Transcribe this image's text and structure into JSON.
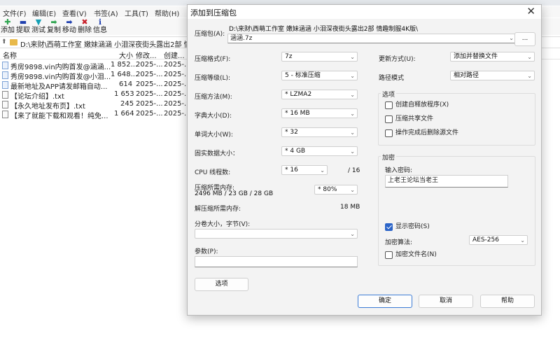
{
  "background": {
    "menu": [
      "文件(F)",
      "编辑(E)",
      "查看(V)",
      "书签(A)",
      "工具(T)",
      "帮助(H)"
    ],
    "toolbar": [
      {
        "label": "添加",
        "icon": "plus-icon",
        "color": "#2ea44f"
      },
      {
        "label": "提取",
        "icon": "minus-icon",
        "color": "#1f3fae"
      },
      {
        "label": "测试",
        "icon": "check-icon",
        "color": "#15a0b5"
      },
      {
        "label": "复制",
        "icon": "arrow-right-icon",
        "color": "#2ea44f"
      },
      {
        "label": "移动",
        "icon": "arrow-right-icon",
        "color": "#1f3fae"
      },
      {
        "label": "删除",
        "icon": "x-icon",
        "color": "#c8202a"
      },
      {
        "label": "信息",
        "icon": "info-icon",
        "color": "#1f3fae"
      }
    ],
    "address": "D:\\来财\\西萌工作室 嫩妹涵涵 小泪深夜街头露出2部 情",
    "columns": {
      "name": "名称",
      "size": "大小",
      "modified": "修改...",
      "created": "创建..."
    },
    "files": [
      {
        "name": "秀房9898.vin内购首发@涵涵...",
        "size": "1 852...",
        "modified": "2025-...",
        "created": "2025-...",
        "type": "image"
      },
      {
        "name": "秀房9898.vin内购首发@小泪...",
        "size": "1 648...",
        "modified": "2025-...",
        "created": "2025-...",
        "type": "image"
      },
      {
        "name": "最新地址及APP请发邮箱自动...",
        "size": "614",
        "modified": "2025-...",
        "created": "2025-...",
        "type": "image"
      },
      {
        "name": "【论坛介绍】.txt",
        "size": "1 653",
        "modified": "2025-...",
        "created": "2025-...",
        "type": "txt"
      },
      {
        "name": "【永久地址发布页】.txt",
        "size": "245",
        "modified": "2025-...",
        "created": "2025-...",
        "type": "txt"
      },
      {
        "name": "【来了就能下载和观看！纯免...",
        "size": "1 664",
        "modified": "2025-...",
        "created": "2025-...",
        "type": "txt"
      }
    ]
  },
  "dialog": {
    "title": "添加到压缩包",
    "archive_label": "压缩包(A):",
    "archive_dir": "D:\\来财\\西萌工作室 嫩妹涵涵 小泪深夜街头露出2部 情趣制服4K版\\",
    "archive_name": "涵涵.7z",
    "browse_label": "...",
    "format_label": "压缩格式(F):",
    "format_value": "7z",
    "level_label": "压缩等级(L):",
    "level_value": "5 - 标准压缩",
    "method_label": "压缩方法(M):",
    "method_value": "* LZMA2",
    "dict_label": "字典大小(D):",
    "dict_value": "* 16 MB",
    "word_label": "单词大小(W):",
    "word_value": "* 32",
    "solid_label": "固实数据大小：",
    "solid_value": "* 4 GB",
    "threads_label": "CPU 线程数:",
    "threads_value": "* 16",
    "threads_max": "/ 16",
    "mem_label": "压缩所需内存:",
    "mem_value": "2496 MB / 23 GB / 28 GB",
    "mem_pct": "* 80%",
    "decomp_label": "解压缩所需内存:",
    "decomp_value": "18 MB",
    "split_label": "分卷大小，字节(V):",
    "split_value": "",
    "params_label": "参数(P):",
    "params_value": "",
    "options_button": "选项",
    "update_label": "更新方式(U):",
    "update_value": "添加并替换文件",
    "path_label": "路径模式",
    "path_value": "相对路径",
    "options_group": "选项",
    "opt_sfx": "创建自释放程序(X)",
    "opt_shared": "压缩共享文件",
    "opt_delete": "操作完成后删除源文件",
    "enc_group": "加密",
    "pwd_label": "输入密码:",
    "pwd_value": "上老王论坛当老王",
    "show_pwd": "显示密码(S)",
    "enc_method_label": "加密算法:",
    "enc_method_value": "AES-256",
    "enc_names": "加密文件名(N)",
    "ok": "确定",
    "cancel": "取消",
    "help": "帮助",
    "close_icon": "✕",
    "accent": "#2b64c8"
  }
}
